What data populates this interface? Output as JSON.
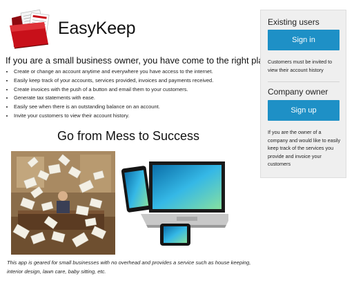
{
  "brand": {
    "name": "EasyKeep",
    "logo_icon": "red-folder-icon"
  },
  "headline": "If you are a small business owner, you have come to the right place!",
  "features": [
    "Create or change an account anytime and everywhere you have access to the internet.",
    "Easily keep track of your accounts, services provided, invoices and payments received.",
    "Create invoices with the push of a button and email them to your customers.",
    "Generate tax statements with ease.",
    "Easily see when there is an outstanding balance on an account.",
    "Invite your customers to view their account history."
  ],
  "subhead": "Go from Mess to Success",
  "images": {
    "mess": "cluttered-office-photo",
    "devices": "devices-icon"
  },
  "note": "This app is geared for small businesses with no overhead and provides a service such as house keeping, interior design, lawn care, baby sitting, etc.",
  "sidebar": {
    "existing_title": "Existing users",
    "signin_label": "Sign in",
    "existing_note": "Customers must be invited to view their account history",
    "owner_title": "Company owner",
    "signup_label": "Sign up",
    "owner_note": "If you are the owner of a company and would like to easily keep track of the services you provide and invoice your customers"
  },
  "colors": {
    "button": "#1e90c6",
    "sidebar_bg": "#efefef",
    "logo_red": "#c8101a"
  }
}
